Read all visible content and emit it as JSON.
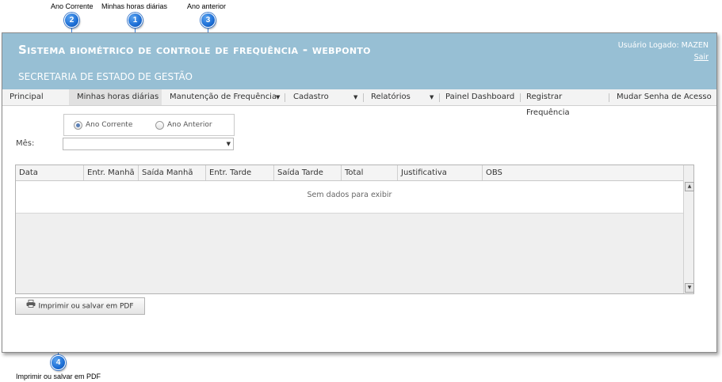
{
  "callouts": [
    {
      "number": "1",
      "label": "Minhas horas diárias"
    },
    {
      "number": "2",
      "label": "Ano Corrente"
    },
    {
      "number": "3",
      "label": "Ano anterior"
    },
    {
      "number": "4",
      "label": "Imprimir ou salvar em PDF"
    }
  ],
  "header": {
    "title": "Sistema biométrico de controle de frequência - webponto",
    "subtitle": "SECRETARIA DE ESTADO DE GESTÃO",
    "user_label": "Usuário Logado: MAZEN",
    "logout_label": "Sair",
    "background_color": "#97bfd4"
  },
  "menu": {
    "items": [
      {
        "label": "Principal",
        "has_dropdown": false,
        "active": false
      },
      {
        "label": "Minhas horas diárias",
        "has_dropdown": false,
        "active": true
      },
      {
        "label": "Manutenção de Frequência",
        "has_dropdown": true,
        "active": false
      },
      {
        "label": "Cadastro",
        "has_dropdown": true,
        "active": false
      },
      {
        "label": "Relatórios",
        "has_dropdown": true,
        "active": false
      },
      {
        "label": "Painel Dashboard",
        "has_dropdown": false,
        "active": false
      },
      {
        "label": "Registrar Frequência",
        "has_dropdown": false,
        "active": false
      },
      {
        "label": "Mudar Senha de Acesso",
        "has_dropdown": false,
        "active": false
      }
    ]
  },
  "filters": {
    "year_options": [
      {
        "label": "Ano Corrente",
        "checked": true
      },
      {
        "label": "Ano Anterior",
        "checked": false
      }
    ],
    "month_label": "Mês:",
    "month_value": ""
  },
  "grid": {
    "columns": [
      "Data",
      "Entr. Manhã",
      "Saída Manhã",
      "Entr. Tarde",
      "Saída Tarde",
      "Total",
      "Justificativa",
      "OBS"
    ],
    "empty_text": "Sem dados para exibir"
  },
  "actions": {
    "pdf_button_label": "Imprimir ou salvar em PDF",
    "pdf_button_icon": "printer-icon"
  }
}
